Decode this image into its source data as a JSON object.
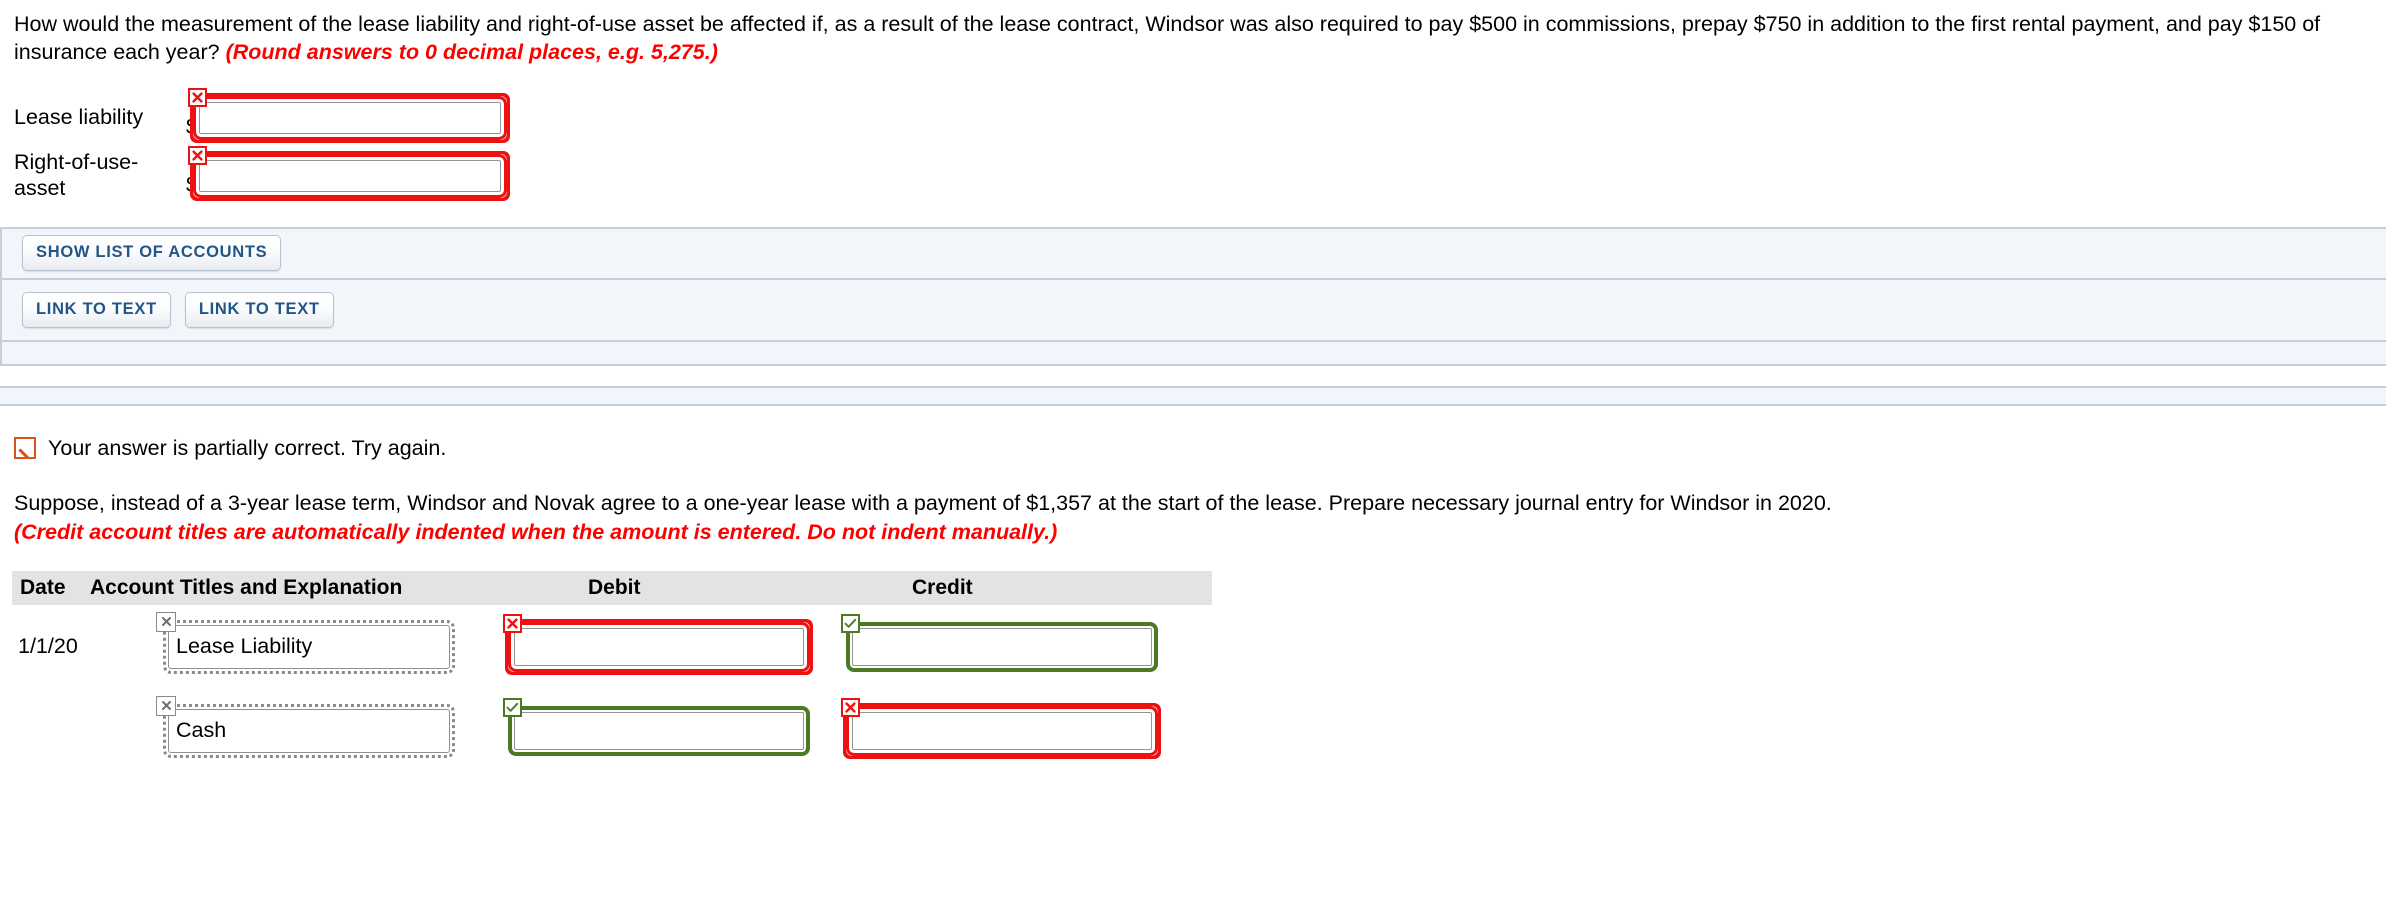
{
  "question1": {
    "text": "How would the measurement of the lease liability and right-of-use asset be affected if, as a result of the lease contract, Windsor was also required to pay $500 in commissions, prepay $750 in addition to the first rental payment, and pay $150 of insurance each year?",
    "hint": "(Round answers to 0 decimal places, e.g. 5,275.)",
    "rows": [
      {
        "label": "Lease liability",
        "currency": "$",
        "value": "",
        "status": "incorrect",
        "status_icon": "x-icon"
      },
      {
        "label": "Right-of-use-asset",
        "currency": "$",
        "value": "",
        "status": "incorrect",
        "status_icon": "x-icon"
      }
    ]
  },
  "toolbar": {
    "show_list_of_accounts_label": "SHOW LIST OF ACCOUNTS",
    "link_to_text_label_1": "LINK TO TEXT",
    "link_to_text_label_2": "LINK TO TEXT"
  },
  "feedback": {
    "icon": "partially-correct-icon",
    "text": "Your answer is partially correct.  Try again."
  },
  "question2": {
    "text": "Suppose, instead of a 3-year lease term, Windsor and Novak agree to a one-year lease with a payment of $1,357 at the start of the lease. Prepare necessary journal entry for Windsor in 2020.",
    "hint": "(Credit account titles are automatically indented when the amount is entered. Do not indent manually.)"
  },
  "journal": {
    "headers": {
      "date": "Date",
      "account": "Account Titles and Explanation",
      "debit": "Debit",
      "credit": "Credit"
    },
    "rows": [
      {
        "date": "1/1/20",
        "account": {
          "value": "Lease Liability",
          "status": "neutral",
          "status_icon": "x-icon"
        },
        "debit": {
          "value": "",
          "status": "incorrect",
          "status_icon": "x-icon"
        },
        "credit": {
          "value": "",
          "status": "correct",
          "status_icon": "check-icon"
        }
      },
      {
        "date": "",
        "account": {
          "value": "Cash",
          "status": "neutral",
          "status_icon": "x-icon"
        },
        "debit": {
          "value": "",
          "status": "correct",
          "status_icon": "check-icon"
        },
        "credit": {
          "value": "",
          "status": "incorrect",
          "status_icon": "x-icon"
        }
      }
    ]
  },
  "colors": {
    "error_red": "#ee1111",
    "success_green": "#4a7a22",
    "hint_red": "#ff0000",
    "partial_orange": "#d9511c",
    "button_blue": "#225588",
    "panel_bg": "#f2f6fa",
    "panel_border": "#c5cedb",
    "table_header_bg": "#e3e3e3"
  }
}
